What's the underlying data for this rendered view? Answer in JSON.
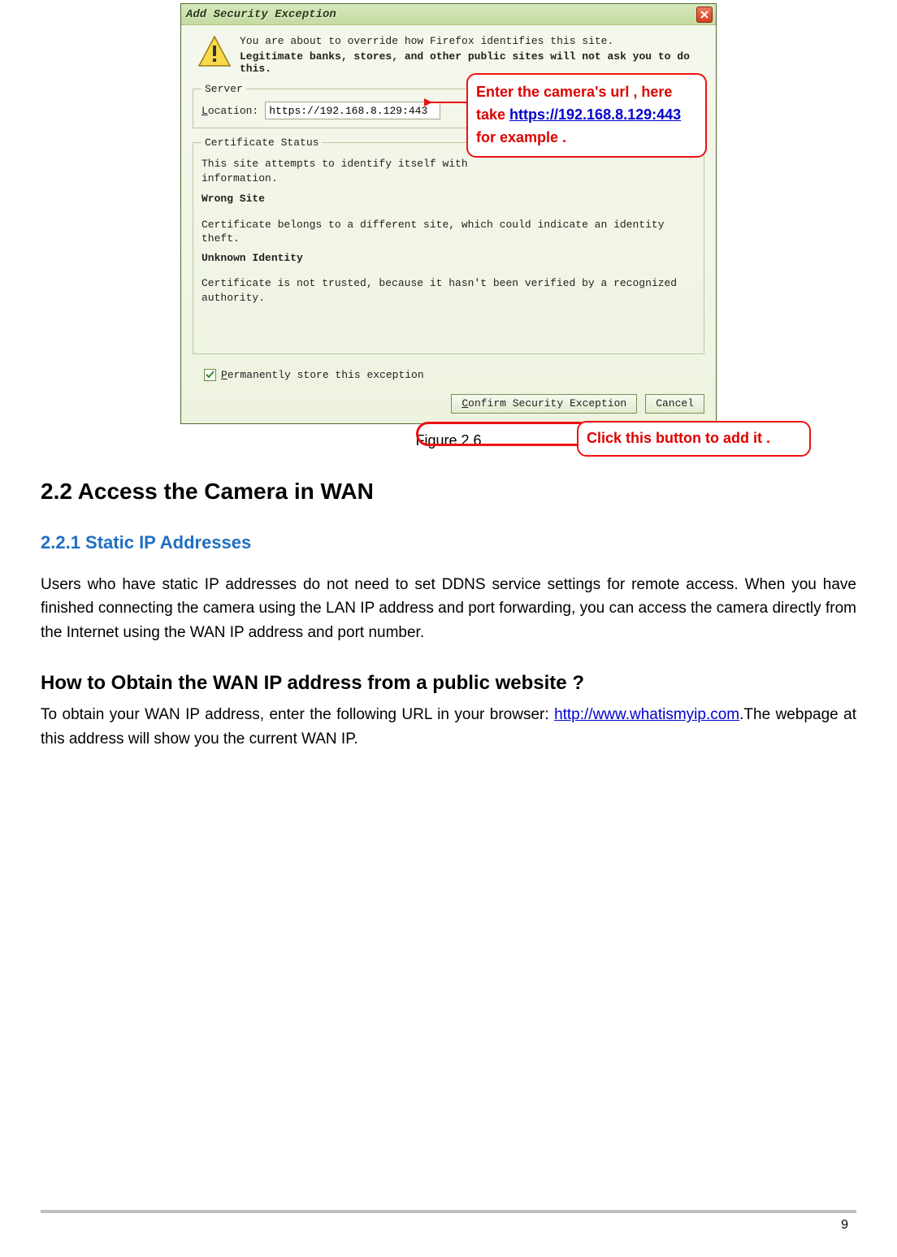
{
  "dialog": {
    "title": "Add Security Exception",
    "intro_line1": "You are about to override how Firefox identifies this site.",
    "intro_line2": "Legitimate banks, stores, and other public sites will not ask you to do this.",
    "server_legend": "Server",
    "location_label": "Location:",
    "location_value": "https://192.168.8.129:443",
    "cert_legend": "Certificate Status",
    "cert_line1": "This site attempts to identify itself with invalid information.",
    "wrong_site": "Wrong Site",
    "wrong_site_text": "Certificate belongs to a different site, which could indicate an identity theft.",
    "unknown_identity": "Unknown Identity",
    "unknown_identity_text": "Certificate is not trusted, because it hasn't been verified by a recognized authority.",
    "permanent_label": "Permanently store this exception",
    "confirm_btn": "Confirm Security Exception",
    "cancel_btn": "Cancel"
  },
  "callouts": {
    "top_pre": "Enter the camera's url , here take   ",
    "top_link": "https://192.168.8.129:443",
    "top_post": " for example .",
    "bottom": "Click this button to add it ."
  },
  "figure_caption": "Figure 2.6",
  "headings": {
    "h2": "2.2 Access the Camera in WAN",
    "h3": "2.2.1 Static IP Addresses",
    "h3b": "How to Obtain the WAN IP address from a public website ?"
  },
  "paragraphs": {
    "p1": "Users who have static IP addresses do not need to set DDNS service settings for remote access. When you have finished connecting the camera using the LAN IP address and port forwarding, you can access the camera directly from the Internet using the WAN IP address and port number.",
    "p2_pre": "To obtain your WAN IP address, enter the following URL in your browser: ",
    "p2_link": "http://www.whatismyip.com",
    "p2_post": ".The webpage at this address will show you the current WAN IP."
  },
  "page_number": "9"
}
